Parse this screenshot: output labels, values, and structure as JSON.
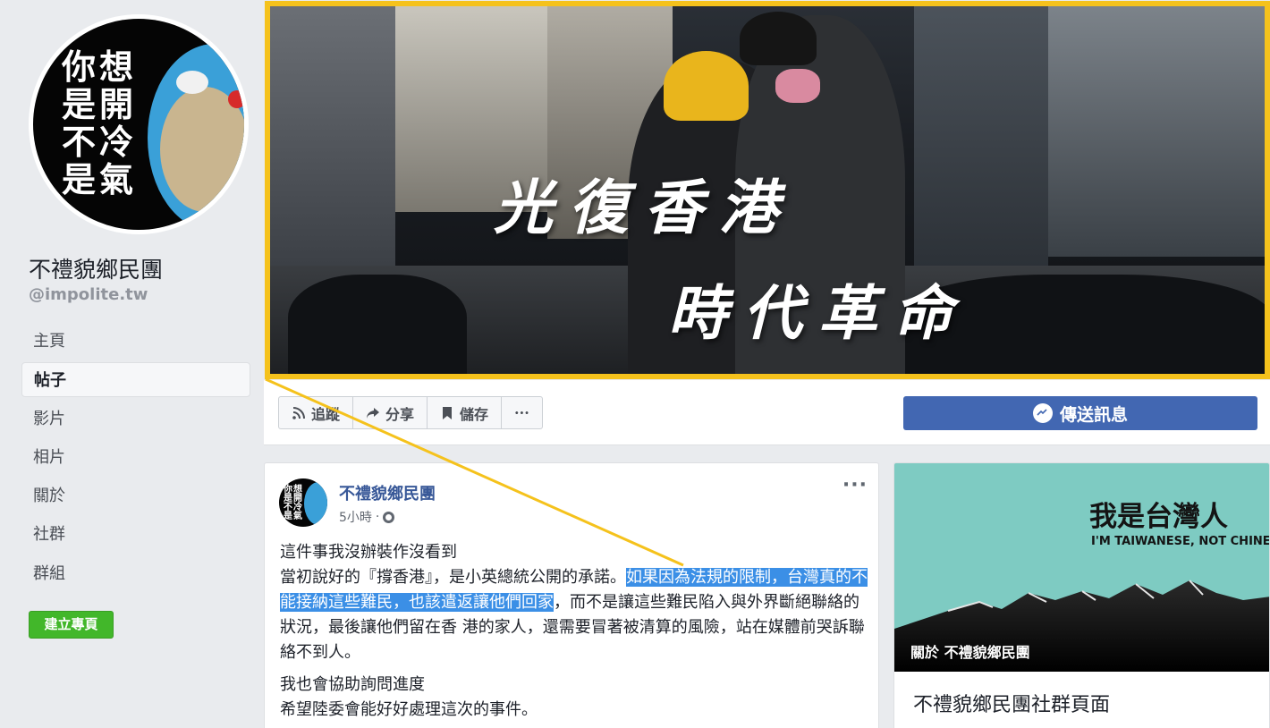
{
  "page": {
    "name": "不禮貌鄉民團",
    "handle": "@impolite.tw",
    "avatar_text": [
      "想",
      "你",
      "開",
      "是",
      "冷",
      "不",
      "氣",
      "是"
    ]
  },
  "nav": {
    "items": [
      {
        "label": "主頁"
      },
      {
        "label": "帖子"
      },
      {
        "label": "影片"
      },
      {
        "label": "相片"
      },
      {
        "label": "關於"
      },
      {
        "label": "社群"
      },
      {
        "label": "群組"
      }
    ],
    "active_index": 1,
    "create_label": "建立專頁"
  },
  "cover": {
    "slogan_line1": "光復香港",
    "slogan_line2": "時代革命",
    "highlight_color": "#f5c21c"
  },
  "actions": {
    "follow_label": "追蹤",
    "share_label": "分享",
    "save_label": "儲存",
    "more_label": "···",
    "message_label": "傳送訊息"
  },
  "post": {
    "author": "不禮貌鄉民團",
    "time": "5小時",
    "meta_sep": "·",
    "more_label": "···",
    "line1": "這件事我沒辦裝作沒看到",
    "para1_plain_a": "當初說好的『撐香港』，是小英總統公開的承諾。",
    "para1_highlight": "如果因為法規的限制，台灣真的不能接納這些難民，也該遣返讓他們回家",
    "para1_plain_b": "，而不是讓這些難民陷入與外界斷絕聯絡的狀況，最後讓他們留在香 港的家人，還需要冒著被清算的風險，站在媒體前哭訴聯絡不到人。",
    "line3": "我也會協助詢問進度",
    "line4": "希望陸委會能好好處理這次的事件。"
  },
  "about_card": {
    "banner_title": "我是台灣人",
    "banner_sub": "I'M TAIWANESE, NOT CHINESE",
    "caption": "關於 不禮貌鄉民團",
    "title": "不禮貌鄉民團社群頁面"
  },
  "colors": {
    "brand_blue": "#4267b2",
    "link_blue": "#385898",
    "create_green": "#42b72a",
    "text_highlight": "#3b8fe6",
    "banner_teal": "#7ecbc2"
  }
}
